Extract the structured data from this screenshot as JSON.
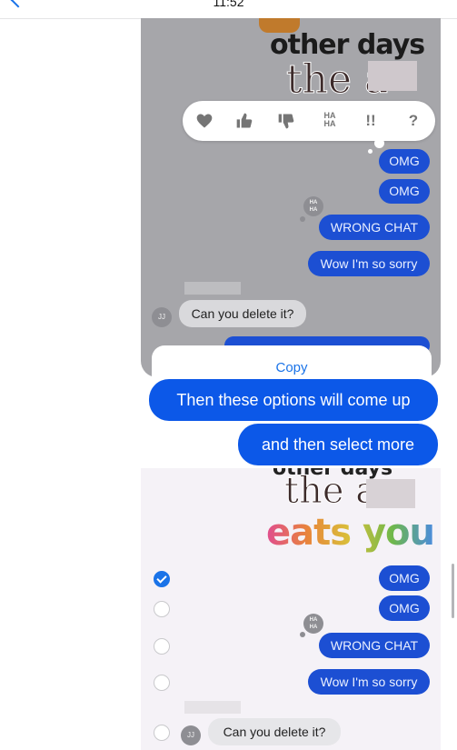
{
  "status_bar": {
    "time": "11:52"
  },
  "video1": {
    "sticker_line1": "other days",
    "sticker_line2": "the a",
    "tapback_icons": [
      "heart-icon",
      "thumbs-up-icon",
      "thumbs-down-icon",
      "haha-icon",
      "exclamation-icon",
      "question-icon"
    ],
    "haha_text": "HA HA",
    "exclaim_text": "!!",
    "question_text": "?",
    "messages": [
      {
        "text": "OMG"
      },
      {
        "text": "OMG"
      },
      {
        "text": "WRONG CHAT"
      },
      {
        "text": "Wow I'm so sorry"
      }
    ],
    "incoming": {
      "avatar": "JJ",
      "text": "Can you delete it?"
    },
    "menu_copy": "Copy"
  },
  "overlay": {
    "line1": "Then these options will come up",
    "line2": "and then select more"
  },
  "video2": {
    "sticker_top": "other days",
    "sticker_the": "the a",
    "sticker_eats": "eats you",
    "messages": [
      {
        "text": "OMG",
        "selected": true
      },
      {
        "text": "OMG",
        "selected": false
      },
      {
        "text": "WRONG CHAT",
        "selected": false
      },
      {
        "text": "Wow I'm so sorry",
        "selected": false
      }
    ],
    "incoming": {
      "avatar": "JJ",
      "text": "Can you delete it?"
    }
  },
  "colors": {
    "bubble_blue": "#1c4fd3",
    "overlay_blue": "#0c58e8",
    "accent": "#1a73e8"
  }
}
